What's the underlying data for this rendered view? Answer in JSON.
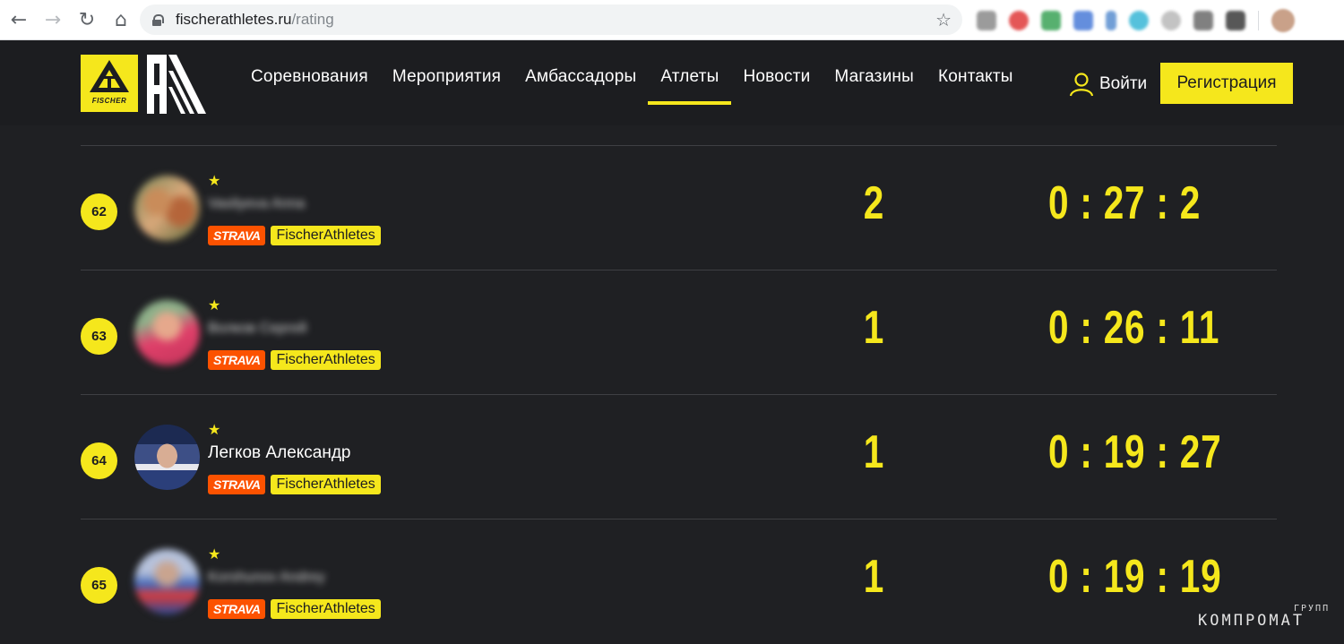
{
  "browser": {
    "url_host": "fischerathletes.ru",
    "url_path": "/rating",
    "back_icon": "arrow-left-icon",
    "forward_icon": "arrow-right-icon",
    "reload_icon": "reload-icon",
    "home_icon": "home-icon",
    "bookmark_icon": "star-icon"
  },
  "header": {
    "logo_text": "FISCHER",
    "nav": [
      {
        "label": "Соревнования"
      },
      {
        "label": "Мероприятия"
      },
      {
        "label": "Амбассадоры"
      },
      {
        "label": "Атлеты",
        "active": true
      },
      {
        "label": "Новости"
      },
      {
        "label": "Магазины"
      },
      {
        "label": "Контакты"
      }
    ],
    "login_label": "Войти",
    "register_label": "Регистрация"
  },
  "colors": {
    "accent": "#f5e71c",
    "background": "#1f2023",
    "strava": "#fc5200"
  },
  "rows": [
    {
      "rank": "62",
      "name": "Vasilyeva Anna",
      "name_blurred": true,
      "strava_label": "STRAVA",
      "team_label": "FischerAthletes",
      "count": "2",
      "time": "0 : 27 : 2"
    },
    {
      "rank": "63",
      "name": "Волков Сергей",
      "name_blurred": true,
      "strava_label": "STRAVA",
      "team_label": "FischerAthletes",
      "count": "1",
      "time": "0 : 26 : 11"
    },
    {
      "rank": "64",
      "name": "Легков Александр",
      "name_blurred": false,
      "strava_label": "STRAVA",
      "team_label": "FischerAthletes",
      "count": "1",
      "time": "0 : 19 : 27"
    },
    {
      "rank": "65",
      "name": "Korshunov Andrey",
      "name_blurred": true,
      "strava_label": "STRAVA",
      "team_label": "FischerAthletes",
      "count": "1",
      "time": "0 : 19 : 19"
    }
  ],
  "watermark": {
    "small": "ГРУПП",
    "main": "КОМПРОМАТ"
  }
}
